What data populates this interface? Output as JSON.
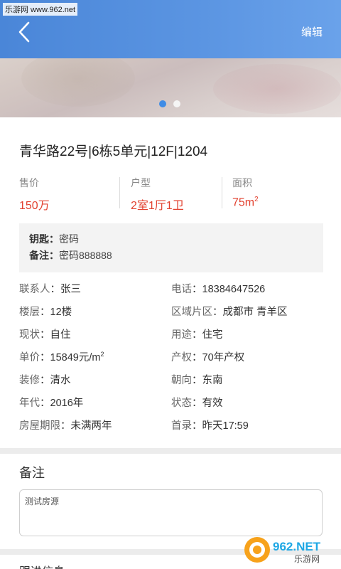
{
  "watermark": {
    "text": "乐游网 www.962.net"
  },
  "header": {
    "back_icon": "chevron-left-icon",
    "edit_label": "编辑",
    "accent": "#4a86d8"
  },
  "carousel": {
    "count": 2,
    "active_index": 0
  },
  "title": "青华路22号|6栋5单元|12F|1204",
  "stats": [
    {
      "label": "售价",
      "value": "150万"
    },
    {
      "label": "户型",
      "value": "2室1厅1卫"
    },
    {
      "label": "面积",
      "value": "75m",
      "unit_sup": "2"
    }
  ],
  "highlight_color": "#e2412f",
  "keybox": {
    "key_label": "钥匙",
    "key_value": "密码",
    "note_label": "备注",
    "note_value": "密码888888"
  },
  "details": [
    {
      "l1": "联系人",
      "v1": "张三",
      "l2": "电话",
      "v2": "18384647526"
    },
    {
      "l1": "楼层",
      "v1": "12楼",
      "l2": "区域片区",
      "v2": "成都市 青羊区"
    },
    {
      "l1": "现状",
      "v1": "自住",
      "l2": "用途",
      "v2": "住宅"
    },
    {
      "l1": "单价",
      "v1": "15849元/m",
      "v1_sup": "2",
      "l2": "产权",
      "v2": "70年产权"
    },
    {
      "l1": "装修",
      "v1": "清水",
      "l2": "朝向",
      "v2": "东南"
    },
    {
      "l1": "年代",
      "v1": "2016年",
      "l2": "状态",
      "v2": "有效"
    },
    {
      "l1": "房屋期限",
      "v1": "未满两年",
      "l2": "首录",
      "v2": "昨天17:59"
    }
  ],
  "remarks": {
    "title": "备注",
    "content": "测试房源"
  },
  "next_section": {
    "title": "跟进信息"
  },
  "logo": {
    "text": "962.NET",
    "subtext": "乐游网"
  }
}
